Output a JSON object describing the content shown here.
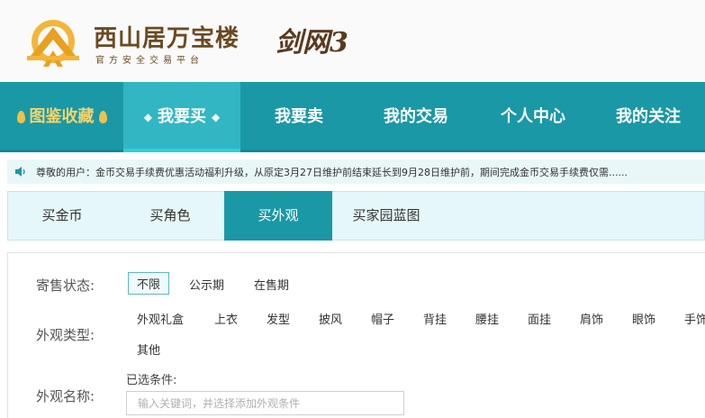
{
  "header": {
    "brand_name": "西山居万宝楼",
    "brand_sub": "官方安全交易平台",
    "game_logo": "剑网3"
  },
  "nav": {
    "items": [
      {
        "label": "图鉴收藏"
      },
      {
        "label": "我要买"
      },
      {
        "label": "我要卖"
      },
      {
        "label": "我的交易"
      },
      {
        "label": "个人中心"
      },
      {
        "label": "我的关注"
      }
    ]
  },
  "notice": {
    "icon": "speaker-icon",
    "text": "尊敬的用户：金币交易手续费优惠活动福利升级，从原定3月27日维护前结束延长到9月28日维护前，期间完成金币交易手续费仅需......"
  },
  "subtabs": [
    {
      "label": "买金币"
    },
    {
      "label": "买角色"
    },
    {
      "label": "买外观"
    },
    {
      "label": "买家园蓝图"
    }
  ],
  "filters": {
    "status": {
      "label": "寄售状态:",
      "options": [
        "不限",
        "公示期",
        "在售期"
      ],
      "selected": "不限"
    },
    "type": {
      "label": "外观类型:",
      "options": [
        "外观礼盒",
        "上衣",
        "发型",
        "披风",
        "帽子",
        "背挂",
        "腰挂",
        "面挂",
        "肩饰",
        "眼饰",
        "手饰",
        "其他"
      ]
    },
    "name": {
      "label": "外观名称:",
      "selected_label": "已选条件:",
      "placeholder": "输入关键词，并选择添加外观条件"
    }
  },
  "colors": {
    "nav_bg": "#1a98a6",
    "nav_active": "#32b6c3",
    "brand_brown": "#6b4a22",
    "gold": "#f0c04d"
  }
}
